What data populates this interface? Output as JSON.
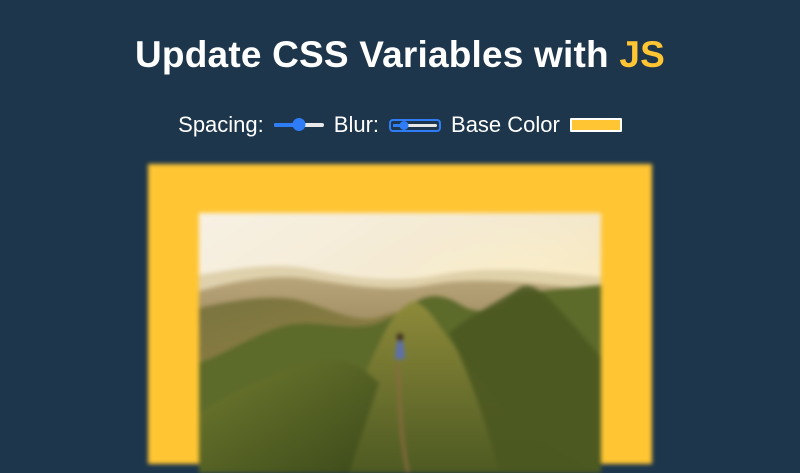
{
  "header": {
    "title_main": "Update CSS Variables with ",
    "title_accent": "JS"
  },
  "controls": {
    "spacing_label": "Spacing:",
    "spacing_value": 0.5,
    "blur_label": "Blur:",
    "blur_value": 0.2,
    "base_color_label": "Base Color"
  },
  "colors": {
    "background": "#1d364b",
    "base": "#ffc533",
    "accent": "#ffc533",
    "slider": "#2e7cf6"
  },
  "image": {
    "icon": "mountain-ridge-photo"
  }
}
